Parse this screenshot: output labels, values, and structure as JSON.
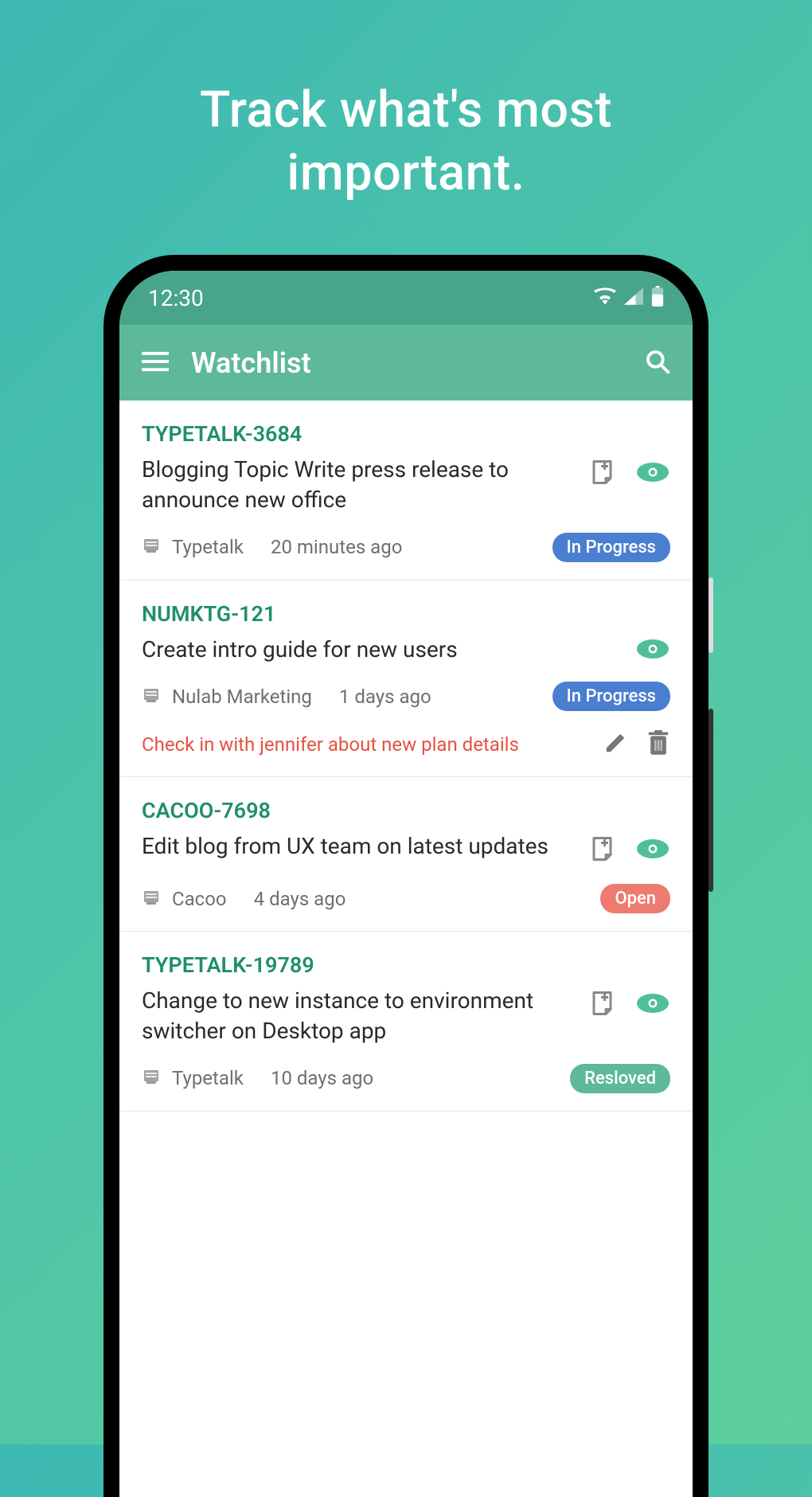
{
  "hero": "Track what's most\nimportant.",
  "status_bar": {
    "time": "12:30"
  },
  "app_bar": {
    "title": "Watchlist"
  },
  "items": [
    {
      "key": "TYPETALK-3684",
      "title": "Blogging Topic Write press release to announce new office",
      "project": "Typetalk",
      "time": "20 minutes ago",
      "status": "In Progress",
      "status_class": "status-inprogress",
      "show_note_icon": true,
      "show_eye": true,
      "note": null
    },
    {
      "key": "NUMKTG-121",
      "title": "Create intro guide for new users",
      "project": "Nulab Marketing",
      "time": "1 days ago",
      "status": "In Progress",
      "status_class": "status-inprogress",
      "show_note_icon": false,
      "show_eye": true,
      "note": "Check in with jennifer about new plan details"
    },
    {
      "key": "CACOO-7698",
      "title": "Edit blog from UX team on latest updates",
      "project": "Cacoo",
      "time": "4 days ago",
      "status": "Open",
      "status_class": "status-open",
      "show_note_icon": true,
      "show_eye": true,
      "note": null
    },
    {
      "key": "TYPETALK-19789",
      "title": "Change to new instance to environment switcher on Desktop app",
      "project": "Typetalk",
      "time": "10 days ago",
      "status": "Resloved",
      "status_class": "status-resolved",
      "show_note_icon": true,
      "show_eye": true,
      "note": null
    }
  ]
}
